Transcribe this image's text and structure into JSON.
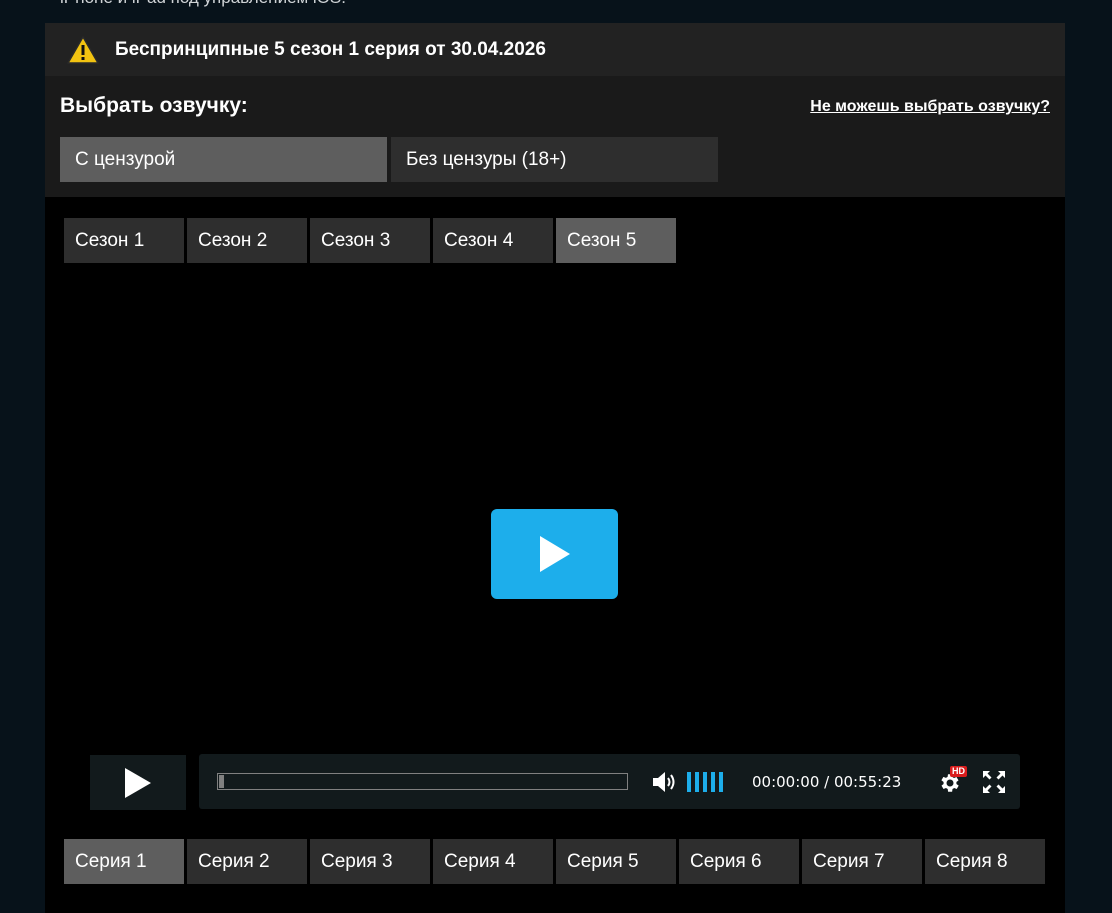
{
  "page": {
    "top_text": "iPhone и iPad под управлением iOS."
  },
  "notice": {
    "icon": "warning-icon",
    "text": "Беспринципные 5 сезон 1 серия от 30.04.2026"
  },
  "dubbing": {
    "title": "Выбрать озвучку:",
    "help_link": "Не можешь выбрать озвучку?",
    "options": [
      {
        "label": "С цензурой",
        "active": true
      },
      {
        "label": "Без цензуры (18+)",
        "active": false
      }
    ]
  },
  "seasons": [
    {
      "label": "Сезон 1",
      "active": false
    },
    {
      "label": "Сезон 2",
      "active": false
    },
    {
      "label": "Сезон 3",
      "active": false
    },
    {
      "label": "Сезон 4",
      "active": false
    },
    {
      "label": "Сезон 5",
      "active": true
    }
  ],
  "player": {
    "time": "00:00:00 / 00:55:23",
    "hd_badge": "HD",
    "accent_color": "#1daeeb",
    "volume_bars": 5,
    "progress": 0
  },
  "episodes": [
    {
      "label": "Серия 1",
      "active": true
    },
    {
      "label": "Серия 2",
      "active": false
    },
    {
      "label": "Серия 3",
      "active": false
    },
    {
      "label": "Серия 4",
      "active": false
    },
    {
      "label": "Серия 5",
      "active": false
    },
    {
      "label": "Серия 6",
      "active": false
    },
    {
      "label": "Серия 7",
      "active": false
    },
    {
      "label": "Серия 8",
      "active": false
    }
  ]
}
